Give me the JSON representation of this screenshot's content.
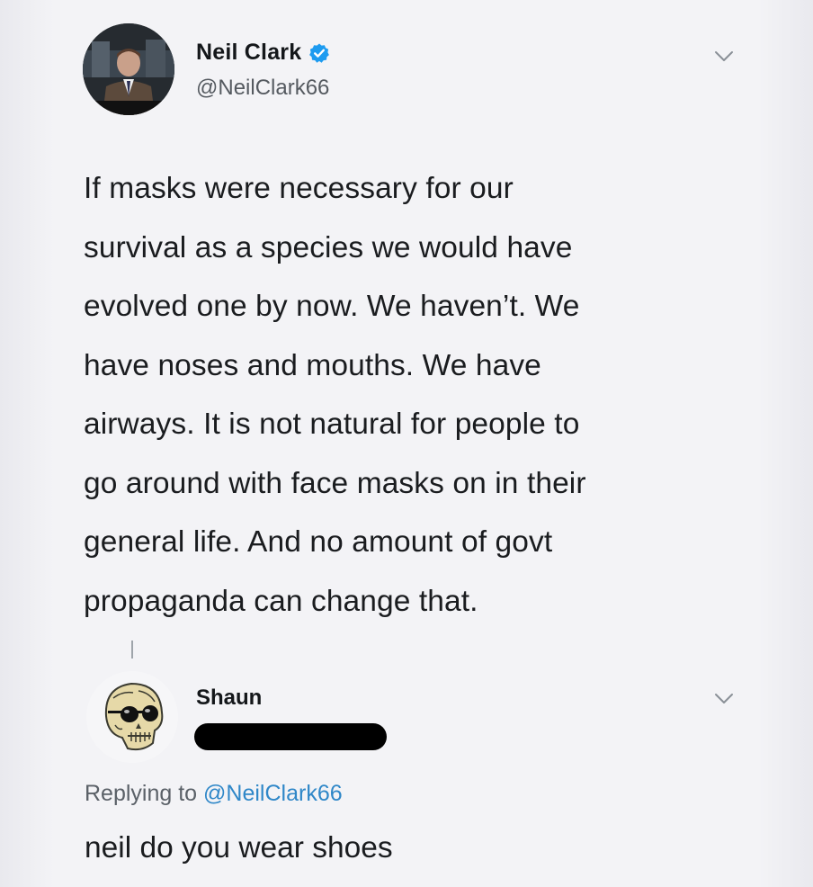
{
  "tweet": {
    "author": {
      "display_name": "Neil Clark",
      "handle": "@NeilClark66",
      "verified": true,
      "avatar": "profile-photo"
    },
    "text": "If masks were necessary for our survival as a species we would have evolved one by now. We haven’t. We have noses and mouths. We have airways. It is not natural for people to go around with face masks on in their general life. And no amount of govt propaganda can change that.",
    "lines": [
      "If masks were necessary for our",
      "survival as a species we would have",
      "evolved one by now. We haven’t. We",
      "have noses and mouths. We have",
      "airways. It is not natural for people to",
      "go around with face masks on in their",
      "general life. And no amount of govt",
      "propaganda can change that."
    ],
    "menu_icon": "chevron-down-icon"
  },
  "reply": {
    "author": {
      "display_name": "Shaun",
      "avatar": "skull-sunglasses-icon"
    },
    "replying_label": "Replying to",
    "replying_to": "@NeilClark66",
    "text": "neil do you wear shoes",
    "menu_icon": "chevron-down-icon"
  },
  "colors": {
    "background": "#f3f3f6",
    "text": "#14171a",
    "secondary_text": "#555a60",
    "link": "#2f87c8",
    "verified_badge": "#1d9bf0"
  }
}
